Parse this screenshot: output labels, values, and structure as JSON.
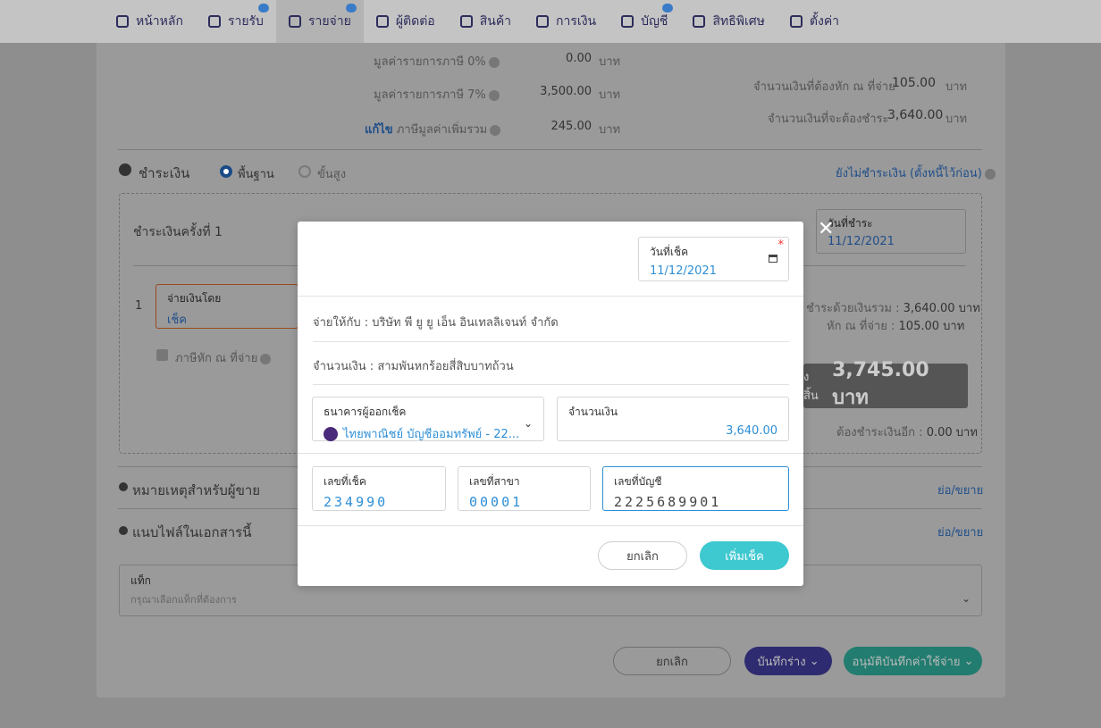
{
  "nav": {
    "items": [
      {
        "label": "หน้าหลัก",
        "icon": "dashboard-icon",
        "badge": false,
        "active": false
      },
      {
        "label": "รายรับ",
        "icon": "income-icon",
        "badge": true,
        "active": false
      },
      {
        "label": "รายจ่าย",
        "icon": "expense-icon",
        "badge": true,
        "active": true
      },
      {
        "label": "ผู้ติดต่อ",
        "icon": "contact-icon",
        "badge": false,
        "active": false
      },
      {
        "label": "สินค้า",
        "icon": "product-icon",
        "badge": false,
        "active": false
      },
      {
        "label": "การเงิน",
        "icon": "finance-icon",
        "badge": false,
        "active": false
      },
      {
        "label": "บัญชี",
        "icon": "accounting-icon",
        "badge": true,
        "active": false
      },
      {
        "label": "สิทธิพิเศษ",
        "icon": "megaphone-icon",
        "badge": false,
        "active": false
      },
      {
        "label": "ตั้งค่า",
        "icon": "gear-icon",
        "badge": false,
        "active": false
      }
    ]
  },
  "summary": {
    "vat0_label": "มูลค่ารายการภาษี 0%",
    "vat0_value": "0.00",
    "vat7_label": "มูลค่ารายการภาษี 7%",
    "vat7_value": "3,500.00",
    "edit_link": "แก้ไข",
    "vat_total_label": "ภาษีมูลค่าเพิ่มรวม",
    "vat_total_value": "245.00",
    "currency": "บาท",
    "wht_label": "จำนวนเงินที่ต้องหัก ณ ที่จ่าย",
    "wht_value": "105.00",
    "due_label": "จำนวนเงินที่จะต้องชำระ",
    "due_value": "3,640.00"
  },
  "payment": {
    "title": "ชำระเงิน",
    "opt_basic": "พื้นฐาน",
    "opt_advanced": "ขั้นสูง",
    "unpaid_link": "ยังไม่ชำระเงิน (ตั้งหนี้ไว้ก่อน)",
    "installment_title": "ชำระเงินครั้งที่ 1",
    "date_label": "วันที่ชำระ",
    "date_value": "11/12/2021",
    "row_no": "1",
    "method_label": "จ่ายเงินโดย",
    "method_value": "เช็ค",
    "wht_checkbox": "ภาษีหัก ณ ที่จ่าย",
    "paid_total_label": "ชำระด้วยเงินรวม :",
    "paid_total_value": "3,640.00 บาท",
    "wht_deduct_label": "หัก ณ ที่จ่าย :",
    "wht_deduct_value": "105.00 บาท",
    "grand_suffix": "งสิ้น",
    "grand_value": "3,745.00 บาท",
    "remaining_label": "ต้องชำระเงินอีก :",
    "remaining_value": "0.00 บาท"
  },
  "notes": {
    "title": "หมายเหตุสำหรับผู้ขาย",
    "toggle": "ย่อ/ขยาย"
  },
  "attach": {
    "title": "แนบไฟล์ในเอกสารนี้",
    "toggle": "ย่อ/ขยาย"
  },
  "tags": {
    "label": "แท็ก",
    "placeholder": "กรุณาเลือกแท็กที่ต้องการ"
  },
  "footer": {
    "cancel": "ยกเลิก",
    "draft": "บันทึกร่าง",
    "approve": "อนุมัติบันทึกค่าใช้จ่าย"
  },
  "modal": {
    "cheque_date_label": "วันที่เช็ค",
    "cheque_date_value": "11/12/2021",
    "payee": "จ่ายให้กับ : บริษัท พี ยู ยู เอ็น อินเทลลิเจนท์ จำกัด",
    "amount_text": "จำนวนเงิน : สามพันหกร้อยสี่สิบบาทถ้วน",
    "bank_label": "ธนาคารผู้ออกเช็ค",
    "bank_value": "ไทยพาณิชย์ บัญชีออมทรัพย์ - 22...",
    "amount_label": "จำนวนเงิน",
    "amount_value": "3,640.00",
    "cheque_no_label": "เลขที่เช็ค",
    "cheque_no_value": "234990",
    "branch_label": "เลขที่สาขา",
    "branch_value": "00001",
    "account_label": "เลขที่บัญชี",
    "account_value": "2225689901",
    "cancel": "ยกเลิก",
    "add": "เพิ่มเช็ค",
    "close_glyph": "✕"
  },
  "colors": {
    "teal": "#3ec8d0",
    "blue_text": "#2e8fd6",
    "draft_btn": "#2f2b70",
    "approve_btn": "#227c6f"
  }
}
